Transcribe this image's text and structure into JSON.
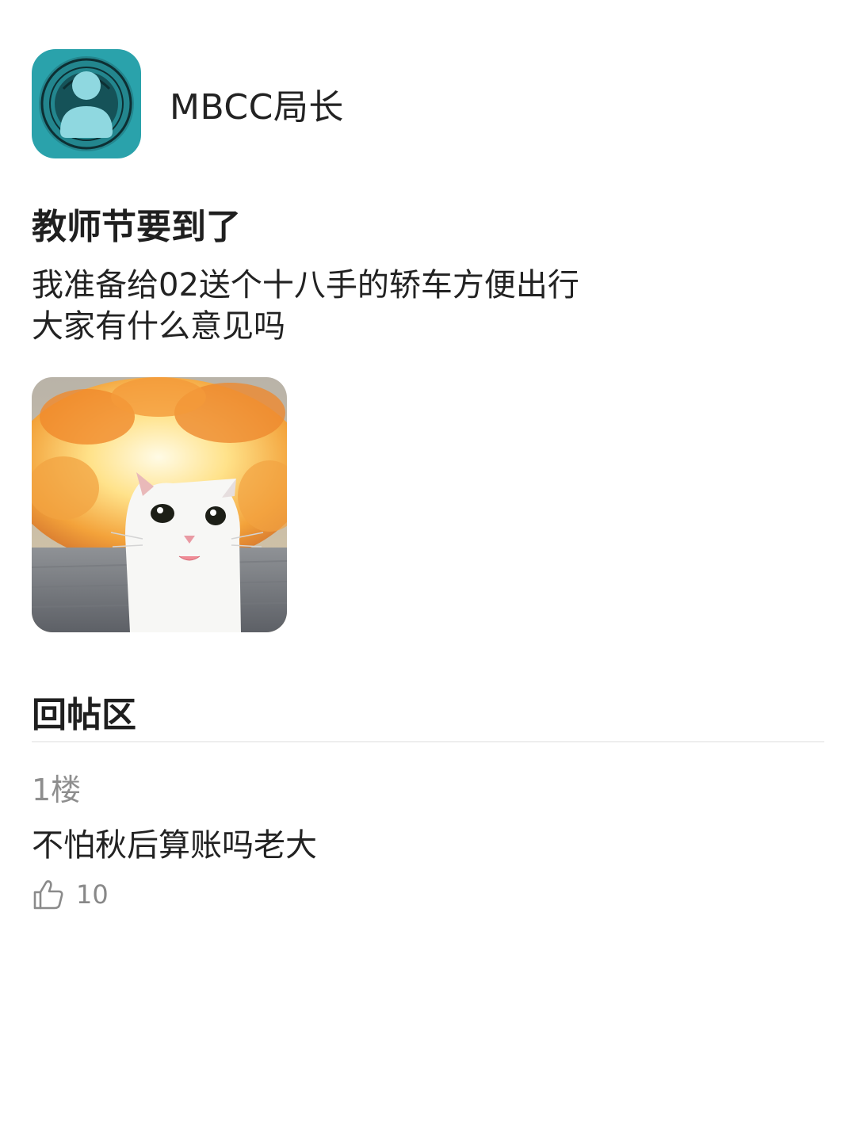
{
  "post": {
    "author_name": "MBCC局长",
    "title": "教师节要到了",
    "body_lines": [
      "我准备给02送个十八手的轿车方便出行",
      "大家有什么意见吗"
    ]
  },
  "replies": {
    "section_title": "回帖区",
    "items": [
      {
        "floor": "1楼",
        "text": "不怕秋后算账吗老大",
        "like_count": "10"
      }
    ]
  },
  "icons": {
    "avatar": "user-silhouette-on-seal",
    "like": "thumbs-up-icon"
  },
  "colors": {
    "avatar_bg": "#2aa2ab",
    "avatar_silhouette": "#8fd8e0",
    "muted_text": "#8e8e8e"
  }
}
